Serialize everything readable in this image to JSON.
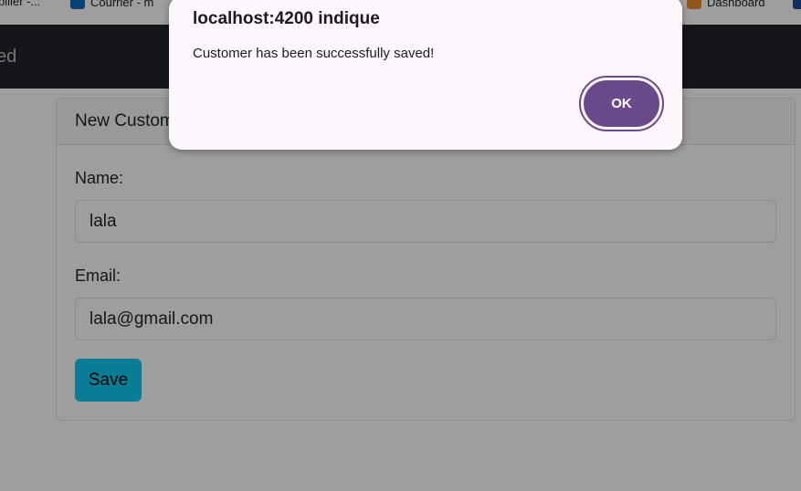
{
  "bookmarks": [
    {
      "label": "pilier -...",
      "icon": "bookmark-icon"
    },
    {
      "label": "Courrier - m",
      "icon": "outlook-icon"
    },
    {
      "label": "Dashboard",
      "icon": "dashboard-icon"
    }
  ],
  "navbar": {
    "brand": "ed"
  },
  "card": {
    "title": "New Customer"
  },
  "form": {
    "name_label": "Name:",
    "name_value": "lala",
    "email_label": "Email:",
    "email_value": "lala@gmail.com",
    "save_label": "Save"
  },
  "dialog": {
    "title": "localhost:4200 indique",
    "message": "Customer has been successfully saved!",
    "ok_label": "OK"
  },
  "colors": {
    "navbar": "#212529",
    "save_button": "#0dcaf0",
    "ok_button": "#6b4a8b",
    "dialog_bg": "#fdf7fd"
  }
}
